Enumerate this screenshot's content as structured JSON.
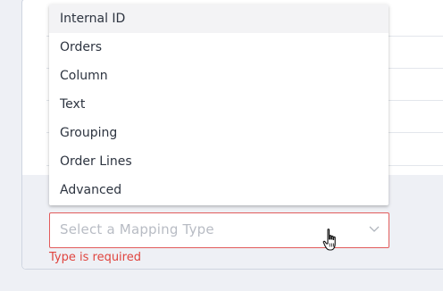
{
  "dropdown": {
    "options": [
      {
        "label": "Internal ID",
        "active": true
      },
      {
        "label": "Orders"
      },
      {
        "label": "Column"
      },
      {
        "label": "Text"
      },
      {
        "label": "Grouping"
      },
      {
        "label": "Order Lines"
      },
      {
        "label": "Advanced"
      }
    ]
  },
  "select": {
    "placeholder": "Select a Mapping Type",
    "icon": "chevron-down-icon"
  },
  "validation": {
    "error": "Type is required",
    "color": "#e0453f"
  },
  "cursor": {
    "icon": "hand-pointer-icon"
  }
}
